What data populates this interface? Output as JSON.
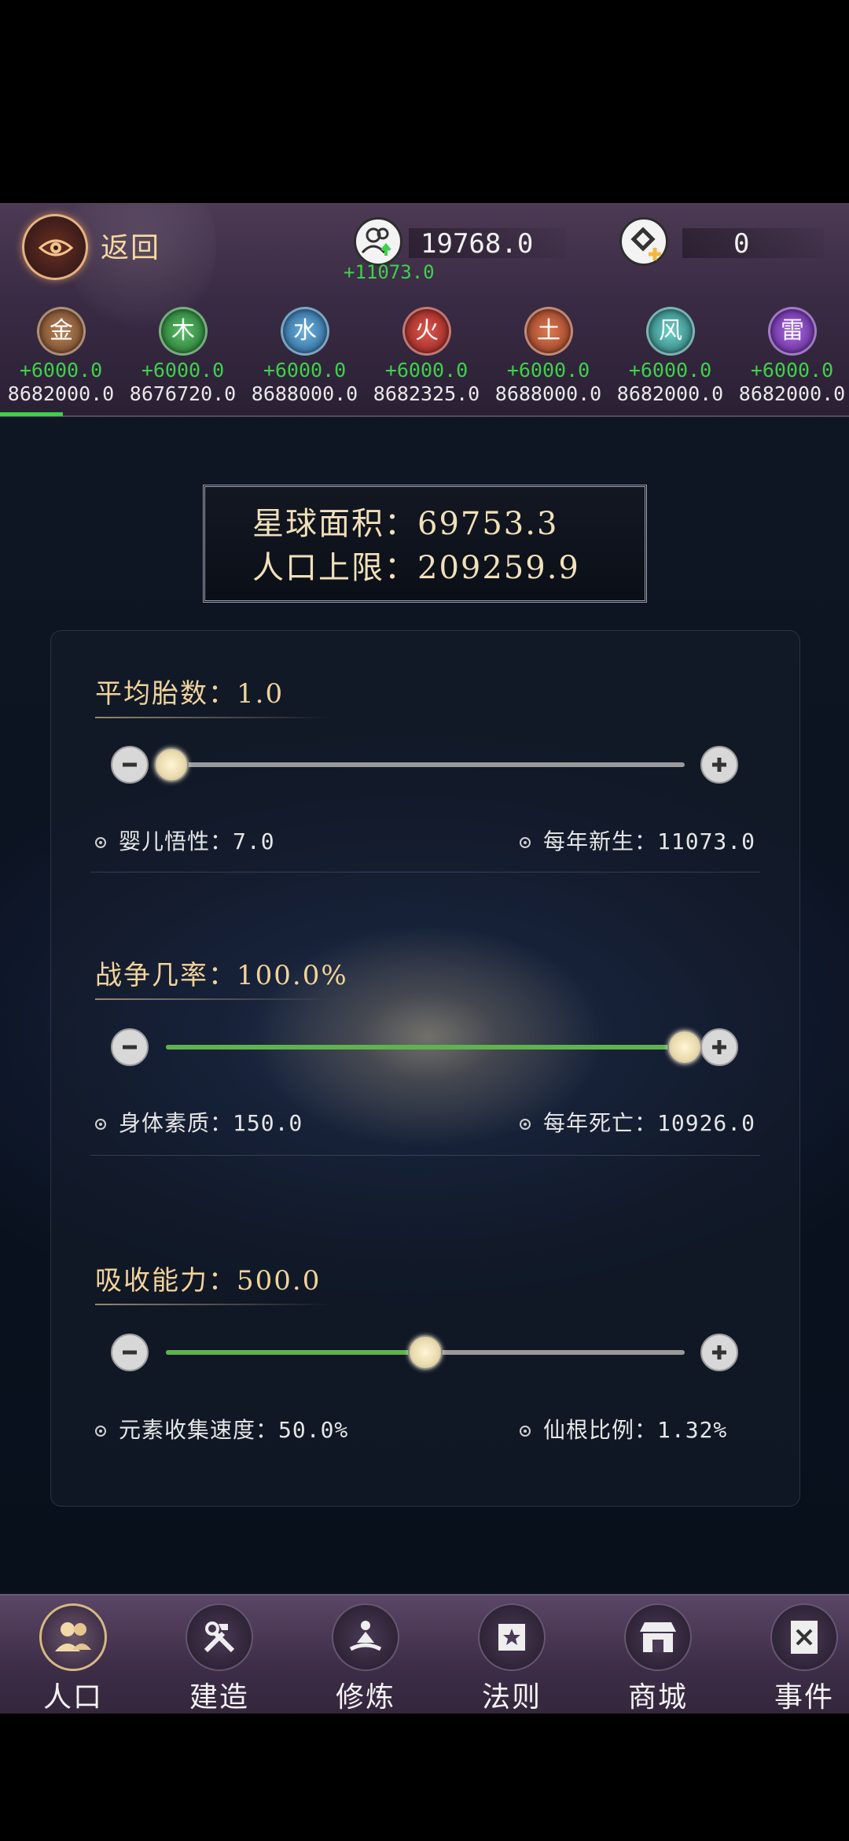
{
  "header": {
    "back_label": "返回",
    "population": {
      "value": "19768.0",
      "gain": "+11073.0"
    },
    "currency": {
      "value": "0"
    }
  },
  "elements": [
    {
      "name": "金",
      "gain": "+6000.0",
      "total": "8682000.0",
      "color": "#8a5a35"
    },
    {
      "name": "木",
      "gain": "+6000.0",
      "total": "8676720.0",
      "color": "#2f8a3e"
    },
    {
      "name": "水",
      "gain": "+6000.0",
      "total": "8688000.0",
      "color": "#3b7fb3"
    },
    {
      "name": "火",
      "gain": "+6000.0",
      "total": "8682325.0",
      "color": "#b8332d"
    },
    {
      "name": "土",
      "gain": "+6000.0",
      "total": "8688000.0",
      "color": "#b5553a"
    },
    {
      "name": "风",
      "gain": "+6000.0",
      "total": "8682000.0",
      "color": "#3f9d9a"
    },
    {
      "name": "雷",
      "gain": "+6000.0",
      "total": "8682000.0",
      "color": "#7d3bb0"
    }
  ],
  "planet": {
    "area_line": "星球面积：69753.3",
    "pop_limit_line": "人口上限：209259.9"
  },
  "sections": [
    {
      "title": "平均胎数：1.0",
      "slider_fraction": 0.01,
      "stat_left": "婴儿悟性：7.0",
      "stat_right": "每年新生：11073.0"
    },
    {
      "title": "战争几率：100.0%",
      "slider_fraction": 1.0,
      "stat_left": "身体素质：150.0",
      "stat_right": "每年死亡：10926.0"
    },
    {
      "title": "吸收能力：500.0",
      "slider_fraction": 0.5,
      "stat_left": "元素收集速度：50.0%",
      "stat_right": "仙根比例：1.32%"
    }
  ],
  "nav": [
    {
      "label": "人口",
      "icon": "people-icon",
      "active": true
    },
    {
      "label": "建造",
      "icon": "tools-icon",
      "active": false
    },
    {
      "label": "修炼",
      "icon": "meditate-icon",
      "active": false
    },
    {
      "label": "法则",
      "icon": "law-book-icon",
      "active": false
    },
    {
      "label": "商城",
      "icon": "shop-icon",
      "active": false
    },
    {
      "label": "事件",
      "icon": "event-book-icon",
      "active": false
    }
  ],
  "colors": {
    "accent_green": "#3fd04b",
    "gold_text": "#f1d39a"
  }
}
